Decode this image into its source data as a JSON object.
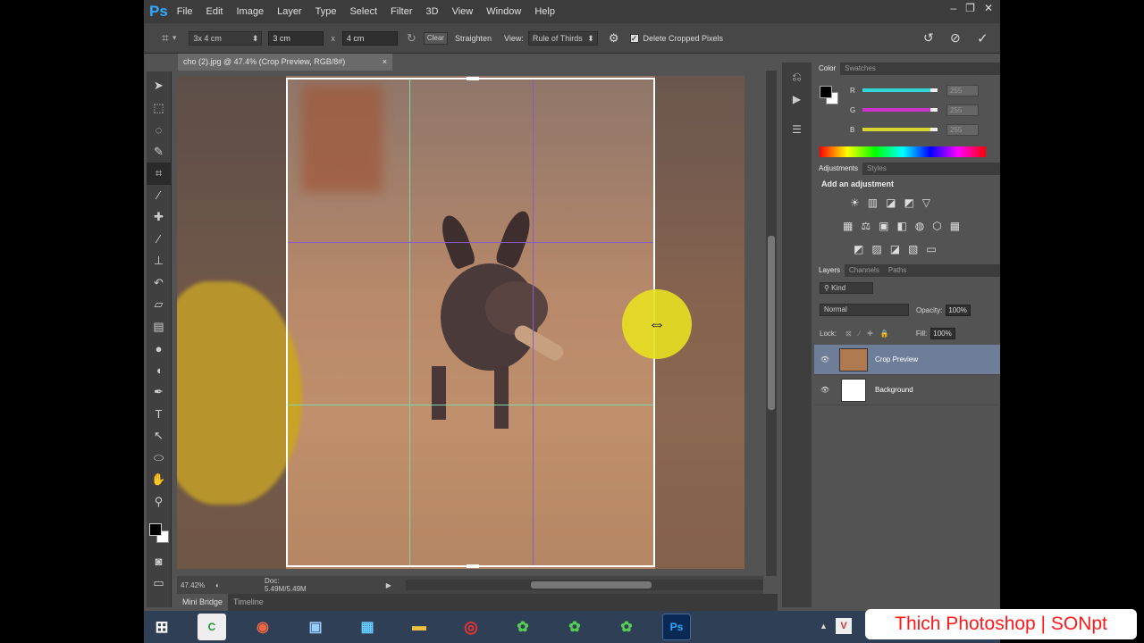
{
  "app": {
    "logo": "Ps"
  },
  "menu": [
    "File",
    "Edit",
    "Image",
    "Layer",
    "Type",
    "Select",
    "Filter",
    "3D",
    "View",
    "Window",
    "Help"
  ],
  "window_controls": {
    "minimize": "–",
    "restore": "❐",
    "close": "✕"
  },
  "options_bar": {
    "preset": "3x 4 cm",
    "width": "3 cm",
    "swap": "x",
    "height": "4 cm",
    "clear": "Clear",
    "straighten": "Straighten",
    "view_label": "View:",
    "view_value": "Rule of Thirds",
    "delete_cropped": "Delete Cropped Pixels"
  },
  "document": {
    "tab_title": "cho (2).jpg @ 47.4% (Crop Preview, RGB/8#)",
    "tab_close": "×"
  },
  "status": {
    "zoom": "47.42%",
    "doc_info": "Doc: 5.49M/5.49M"
  },
  "bottom_tabs": [
    "Mini Bridge",
    "Timeline"
  ],
  "color_panel": {
    "tabs": [
      "Color",
      "Swatches"
    ],
    "channels": [
      {
        "label": "R",
        "value": "255",
        "fill": 0.9,
        "color": "#2ed6d6"
      },
      {
        "label": "G",
        "value": "255",
        "fill": 0.9,
        "color": "#cc33cc"
      },
      {
        "label": "B",
        "value": "255",
        "fill": 0.9,
        "color": "#d6d62e"
      }
    ]
  },
  "adjustments_panel": {
    "tabs": [
      "Adjustments",
      "Styles"
    ],
    "heading": "Add an adjustment"
  },
  "layers_panel": {
    "tabs": [
      "Layers",
      "Channels",
      "Paths"
    ],
    "filter_kind": "Kind",
    "blend_mode": "Normal",
    "opacity_label": "Opacity:",
    "opacity_value": "100%",
    "lock_label": "Lock:",
    "fill_label": "Fill:",
    "fill_value": "100%",
    "layers": [
      {
        "name": "Crop Preview",
        "selected": true
      },
      {
        "name": "Background",
        "selected": false
      }
    ]
  },
  "watermark": "Thich Photoshop | SONpt",
  "colors": {
    "accent": "#31a8ff",
    "grid_green": "#7fd6a8",
    "grid_purple": "#8a5ac8",
    "cursor_yellow": "#e8e020"
  }
}
